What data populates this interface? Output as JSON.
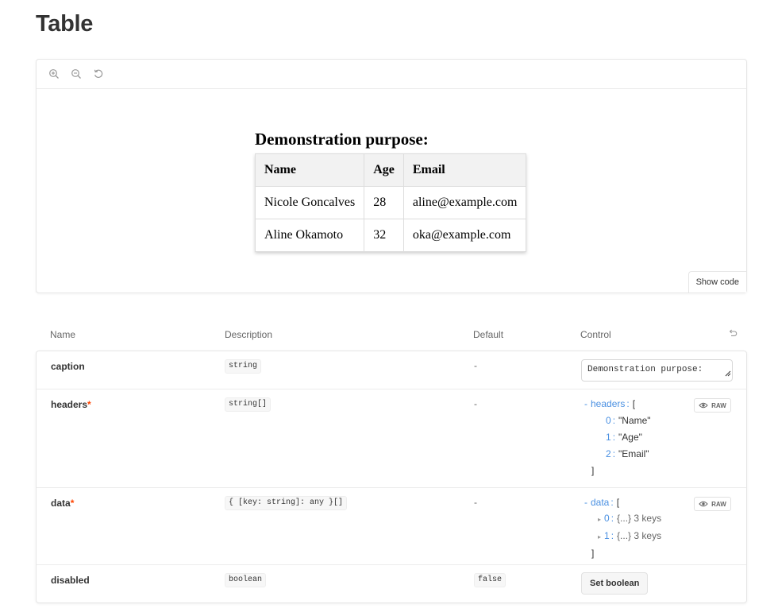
{
  "page": {
    "title": "Table"
  },
  "toolbar": {
    "zoom_in_icon": "zoom-in-icon",
    "zoom_out_icon": "zoom-out-icon",
    "reset_zoom_icon": "reset-zoom-icon"
  },
  "demo": {
    "caption": "Demonstration purpose:",
    "headers": [
      "Name",
      "Age",
      "Email"
    ],
    "rows": [
      [
        "Nicole Goncalves",
        "28",
        "aline@example.com"
      ],
      [
        "Aline Okamoto",
        "32",
        "oka@example.com"
      ]
    ]
  },
  "show_code_label": "Show code",
  "args_table": {
    "columns": {
      "name": "Name",
      "description": "Description",
      "default": "Default",
      "control": "Control"
    },
    "rows": {
      "caption": {
        "name": "caption",
        "type": "string",
        "default": "-",
        "control_value": "Demonstration purpose:"
      },
      "headers": {
        "name": "headers",
        "required_mark": "*",
        "type": "string[]",
        "default": "-",
        "tree_key": "headers",
        "open_bracket": "[",
        "close_bracket": "]",
        "items": [
          {
            "index": "0",
            "value": "\"Name\""
          },
          {
            "index": "1",
            "value": "\"Age\""
          },
          {
            "index": "2",
            "value": "\"Email\""
          }
        ],
        "raw_label": "RAW"
      },
      "data": {
        "name": "data",
        "required_mark": "*",
        "type": "{ [key: string]: any }[]",
        "default": "-",
        "tree_key": "data",
        "open_bracket": "[",
        "close_bracket": "]",
        "items": [
          {
            "index": "0",
            "value": "{...} 3 keys"
          },
          {
            "index": "1",
            "value": "{...} 3 keys"
          }
        ],
        "raw_label": "RAW"
      },
      "disabled": {
        "name": "disabled",
        "type": "boolean",
        "default": "false",
        "button_label": "Set boolean"
      }
    }
  }
}
